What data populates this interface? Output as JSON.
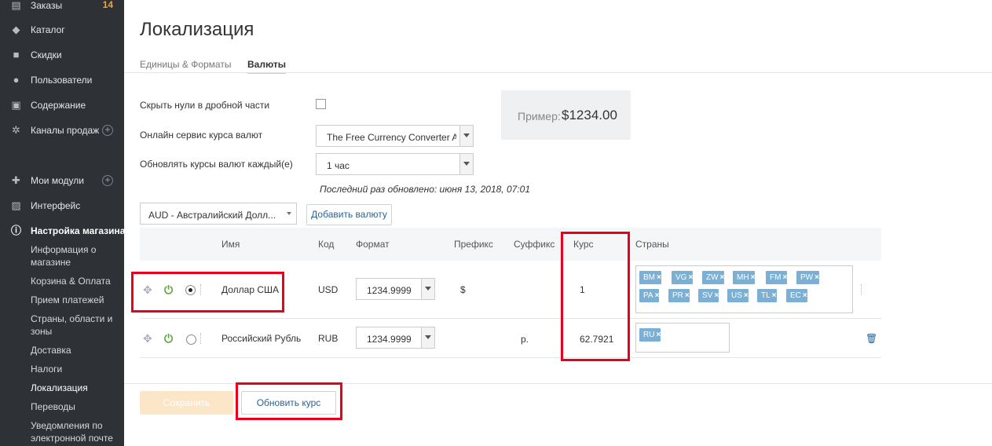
{
  "sidebar": {
    "orders": {
      "label": "Заказы",
      "count": "14"
    },
    "catalog": "Каталог",
    "discounts": "Скидки",
    "users": "Пользователи",
    "content": "Содержание",
    "sales_channels": "Каналы продаж",
    "my_modules": "Мои модули",
    "interface": "Интерфейс",
    "store_settings": "Настройка магазина",
    "sub": {
      "store_info": "Информация о магазине",
      "cart_payment": "Корзина & Оплата",
      "payment_acceptance": "Прием платежей",
      "countries": "Страны, области и зоны",
      "delivery": "Доставка",
      "taxes": "Налоги",
      "localization": "Локализация",
      "translations": "Переводы",
      "email_notifications": "Уведомления по электронной почте"
    }
  },
  "page": {
    "title": "Локализация",
    "tabs": [
      "Единицы & Форматы",
      "Валюты"
    ]
  },
  "settings": {
    "hide_zeros_label": "Скрыть нули в дробной части",
    "hide_zeros_checked": false,
    "service_label": "Онлайн сервис курса валют",
    "service_value": "The Free Currency Converter A",
    "update_label": "Обновлять курсы валют каждый(е)",
    "update_value": "1 час",
    "last_updated": "Последний раз обновлено: июня 13, 2018, 07:01",
    "example_label": "Пример:",
    "example_value": "$1234.00"
  },
  "add_currency": {
    "select_value": "AUD - Австралийский Долл...",
    "button": "Добавить валюту"
  },
  "table": {
    "headers": {
      "name": "Имя",
      "code": "Код",
      "format": "Формат",
      "prefix": "Префикс",
      "suffix": "Суффикс",
      "rate": "Курс",
      "countries": "Страны"
    },
    "rows": [
      {
        "name": "Доллар США",
        "code": "USD",
        "format": "1234.9999",
        "prefix": "$",
        "suffix": "",
        "rate": "1",
        "default": true,
        "countries": [
          "BM",
          "VG",
          "ZW",
          "MH",
          "FM",
          "PW",
          "PA",
          "PR",
          "SV",
          "US",
          "TL",
          "EC"
        ]
      },
      {
        "name": "Российский Рубль",
        "code": "RUB",
        "format": "1234.9999",
        "prefix": "",
        "suffix": "р.",
        "rate": "62.7921",
        "default": false,
        "countries": [
          "RU"
        ]
      }
    ]
  },
  "footer": {
    "save": "Сохранить",
    "update_rate": "Обновить курс"
  },
  "colors": {
    "sidebar_bg": "#2e3136",
    "tag_bg": "#7bafd4",
    "highlight": "#e8001c",
    "power_green": "#5aa83c",
    "save_disabled": "#fbe6c8"
  },
  "icons": [
    "orders-icon",
    "tag-icon",
    "gift-icon",
    "users-icon",
    "content-icon",
    "sales-channels-icon",
    "puzzle-icon",
    "image-icon",
    "info-icon",
    "drag-handle-icon",
    "power-icon",
    "trash-icon",
    "close-icon",
    "chevron-down-icon"
  ]
}
